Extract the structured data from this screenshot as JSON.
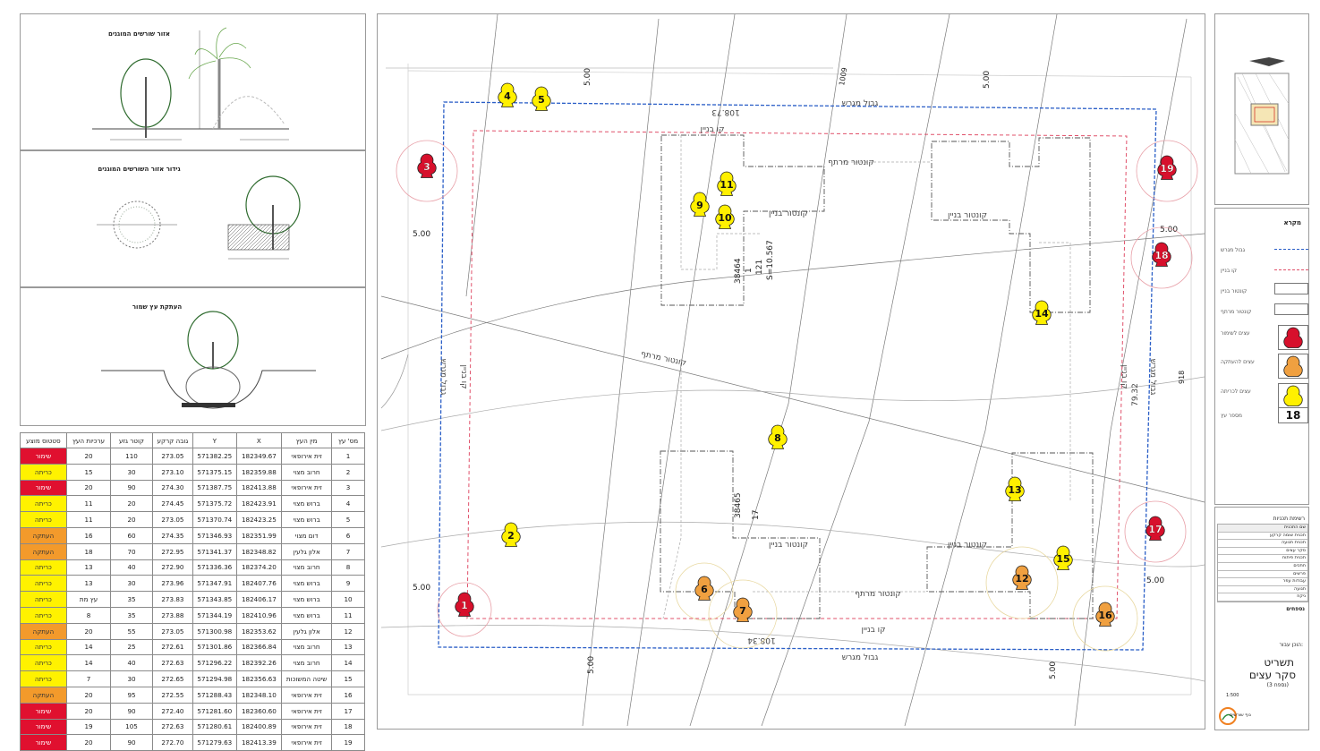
{
  "left_panels": {
    "panel1_title": "אזור שורשים המוגנים",
    "panel2_title": "גידור אזור השורשים המוגנים",
    "panel3_title": "העתקת עץ שמור"
  },
  "table": {
    "headers": [
      "מס' עץ",
      "מין העץ",
      "X",
      "Y",
      "גובה קרקע",
      "קוטר גזע",
      "ערכיות העץ",
      "סטטוס מוצע"
    ],
    "rows": [
      [
        "1",
        "זית אירופאי",
        "182349.67",
        "571382.25",
        "273.05",
        "110",
        "20",
        "שימור",
        "cut"
      ],
      [
        "2",
        "חרוב מצוי",
        "182359.88",
        "571375.15",
        "273.10",
        "30",
        "15",
        "כריתה",
        "fell"
      ],
      [
        "3",
        "זית אירופאי",
        "182413.88",
        "571387.75",
        "274.30",
        "90",
        "20",
        "שימור",
        "cut"
      ],
      [
        "4",
        "ברוש מצוי",
        "182423.91",
        "571375.72",
        "274.45",
        "20",
        "11",
        "כריתה",
        "fell"
      ],
      [
        "5",
        "ברוש מצוי",
        "182423.25",
        "571370.74",
        "273.05",
        "20",
        "11",
        "כריתה",
        "fell"
      ],
      [
        "6",
        "דום מצוי",
        "182351.99",
        "571346.93",
        "274.35",
        "60",
        "16",
        "העתקה",
        "move"
      ],
      [
        "7",
        "אלון גלעין",
        "182348.82",
        "571341.37",
        "272.95",
        "70",
        "18",
        "העתקה",
        "move"
      ],
      [
        "8",
        "חרוב מצוי",
        "182374.20",
        "571336.36",
        "272.90",
        "40",
        "13",
        "כריתה",
        "fell"
      ],
      [
        "9",
        "ברוש מצוי",
        "182407.76",
        "571347.91",
        "273.96",
        "30",
        "13",
        "כריתה",
        "fell"
      ],
      [
        "10",
        "ברוש מצוי",
        "182406.17",
        "571343.85",
        "273.83",
        "35",
        "עץ מת",
        "כריתה",
        "fell"
      ],
      [
        "11",
        "ברוש מצוי",
        "182410.96",
        "571344.19",
        "273.88",
        "35",
        "8",
        "כריתה",
        "fell"
      ],
      [
        "12",
        "אלון גלעין",
        "182353.62",
        "571300.98",
        "273.05",
        "55",
        "20",
        "העתקה",
        "move"
      ],
      [
        "13",
        "חרוב מצוי",
        "182366.84",
        "571301.86",
        "272.61",
        "25",
        "14",
        "כריתה",
        "fell"
      ],
      [
        "14",
        "חרוב מצוי",
        "182392.26",
        "571296.22",
        "272.63",
        "40",
        "14",
        "כריתה",
        "fell"
      ],
      [
        "15",
        "שיטה המשוכות",
        "182356.63",
        "571294.98",
        "272.65",
        "30",
        "7",
        "כריתה",
        "fell"
      ],
      [
        "16",
        "זית אירופאי",
        "182348.10",
        "571288.43",
        "272.55",
        "95",
        "20",
        "העתקה",
        "move"
      ],
      [
        "17",
        "זית אירופאי",
        "182360.60",
        "571281.60",
        "272.40",
        "90",
        "20",
        "שימור",
        "cut"
      ],
      [
        "18",
        "זית אירופאי",
        "182400.89",
        "571280.61",
        "272.63",
        "105",
        "19",
        "שימור",
        "cut"
      ],
      [
        "19",
        "זית אירופאי",
        "182413.39",
        "571279.63",
        "272.70",
        "90",
        "20",
        "שימור",
        "cut"
      ]
    ]
  },
  "map": {
    "street_top": "גבול מגרש",
    "street_bottom": "גבול מגרש",
    "build_line_top": "קו בניין",
    "build_line_bottom": "קו בניין",
    "build_line_left": "קו בניין",
    "build_line_right": "קו בניין",
    "contour_label": "קונטור מרתף",
    "building_contour": "קונטור בניין",
    "dim_top": "108.73",
    "dim_bottom": "108.34",
    "dim_right": "79.32",
    "setback_a": "5.00",
    "setback_b": "5.00",
    "setback_c": "5.00",
    "setback_d": "5.00",
    "setback_e": "5.00",
    "setback_f": "5.00",
    "setback_g": "5.00",
    "setback_h": "5.00",
    "parcel_1": "38464",
    "parcel_1b": "1",
    "parcel_1c": "121",
    "parcel_area": "S=10.567",
    "parcel_2": "38465",
    "parcel_2b": "17",
    "elev_label": "1009",
    "elev_label2": "918",
    "trees": [
      {
        "n": "1",
        "s": "cut"
      },
      {
        "n": "2",
        "s": "fell"
      },
      {
        "n": "3",
        "s": "cut"
      },
      {
        "n": "4",
        "s": "fell"
      },
      {
        "n": "5",
        "s": "fell"
      },
      {
        "n": "6",
        "s": "move"
      },
      {
        "n": "7",
        "s": "move"
      },
      {
        "n": "8",
        "s": "fell"
      },
      {
        "n": "9",
        "s": "fell"
      },
      {
        "n": "10",
        "s": "fell"
      },
      {
        "n": "11",
        "s": "fell"
      },
      {
        "n": "12",
        "s": "move"
      },
      {
        "n": "13",
        "s": "fell"
      },
      {
        "n": "14",
        "s": "fell"
      },
      {
        "n": "15",
        "s": "fell"
      },
      {
        "n": "16",
        "s": "move"
      },
      {
        "n": "17",
        "s": "cut"
      },
      {
        "n": "18",
        "s": "cut"
      },
      {
        "n": "19",
        "s": "cut"
      }
    ]
  },
  "legend": {
    "title": "מקרא",
    "items": [
      "גבול מגרש",
      "קו בניין",
      "קונטור בניין",
      "קונטור מרתף",
      "עצים לשימור",
      "עצים להעתקה",
      "עצים לכריתה",
      "מספר עץ"
    ],
    "tree_number_sample": "18"
  },
  "title_block": {
    "table_title": "רשימת תכניות",
    "col_a": "שם התכנית",
    "col_b": "קנ\"מ",
    "rows": [
      "תכנית שומה קרקע",
      "תכנית תנועה",
      "סקר עצים",
      "תכנית פיתוח",
      "חתכים",
      "פרשים",
      "עבודות עפר",
      "תנועה",
      "ניקוז"
    ],
    "notes_title": "נספחים",
    "prepared_by": "הוכן עבור:",
    "drawing_label": "תשריט",
    "drawing_name": "סקר עצים",
    "drawing_sub": "(נספח 3)",
    "scale_label": "1:500",
    "company": "נוף שורשים",
    "colors": {
      "cut": "#d7102c",
      "move": "#f0a040",
      "fell": "#fff000"
    }
  }
}
